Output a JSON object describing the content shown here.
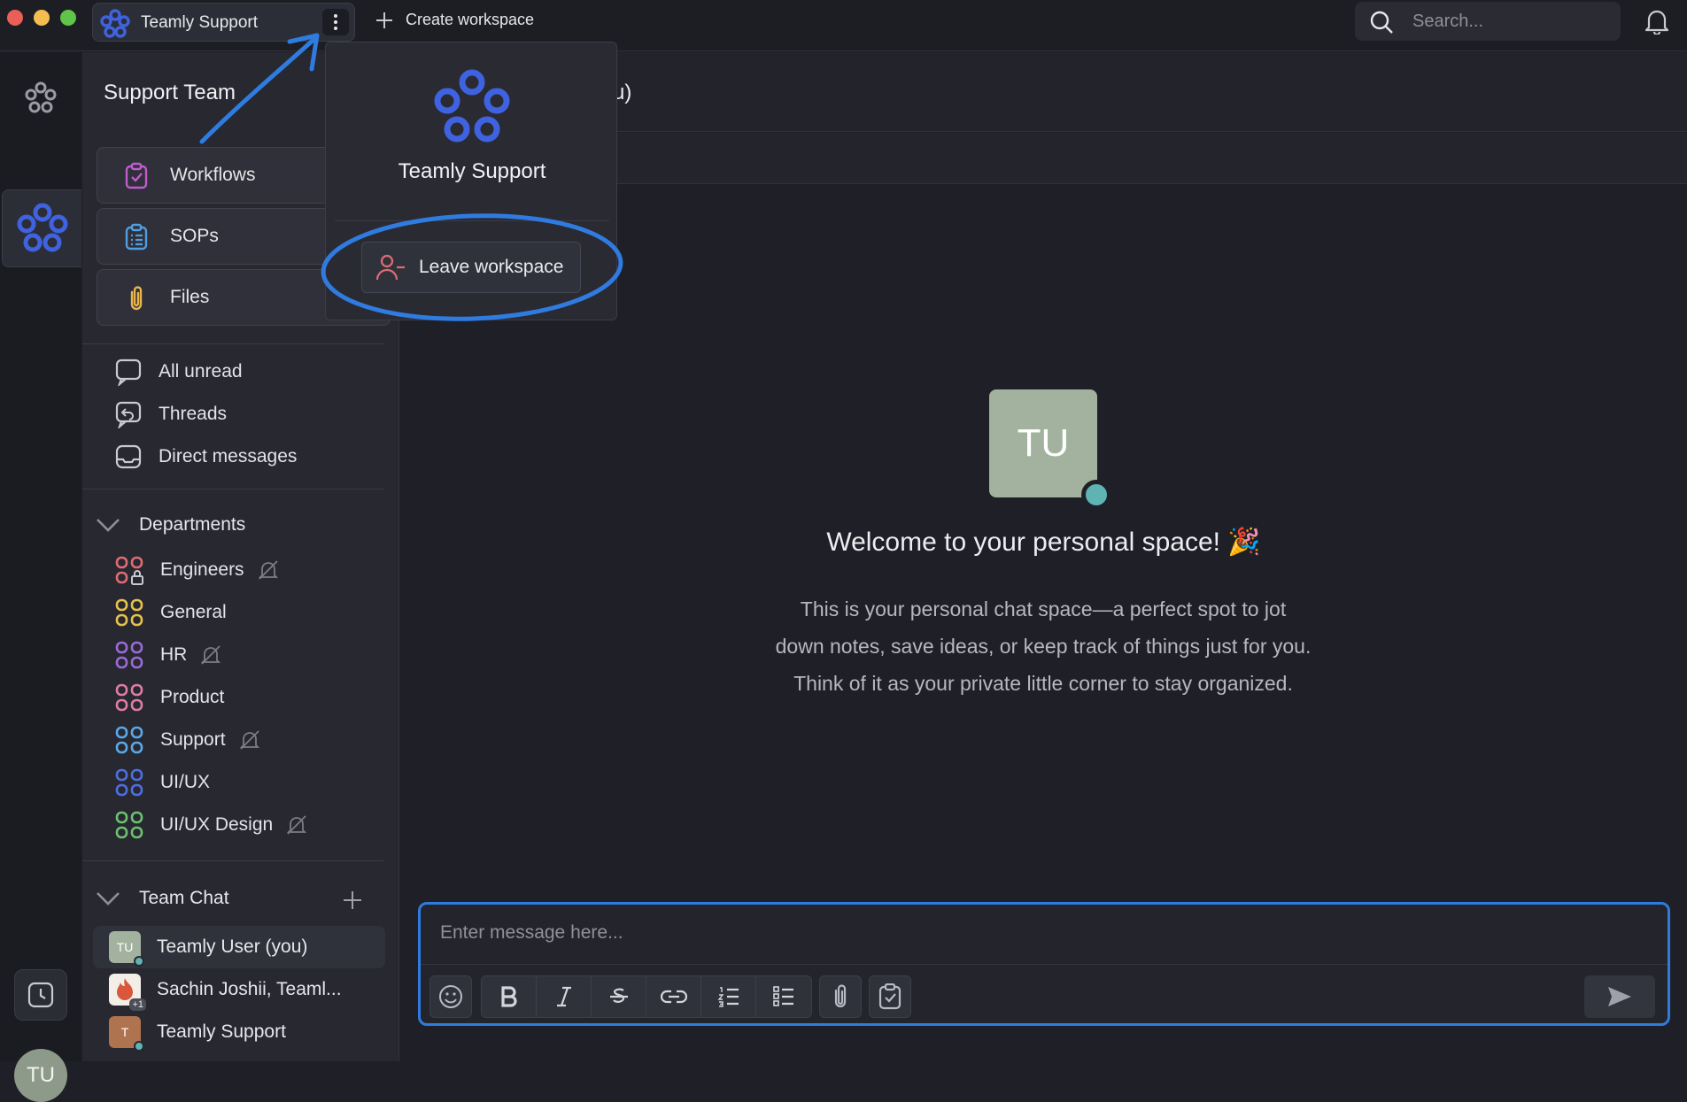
{
  "titlebar": {
    "workspace_name": "Teamly Support",
    "create_workspace_label": "Create workspace",
    "search_placeholder": "Search..."
  },
  "sidebar": {
    "title": "Support Team",
    "cards": [
      {
        "label": "Workflows",
        "icon": "clipboard-check-icon"
      },
      {
        "label": "SOPs",
        "icon": "clipboard-list-icon"
      },
      {
        "label": "Files",
        "icon": "paperclip-icon"
      }
    ],
    "nav": [
      {
        "label": "All unread",
        "icon": "chat-bubble-icon"
      },
      {
        "label": "Threads",
        "icon": "thread-reply-icon"
      },
      {
        "label": "Direct messages",
        "icon": "inbox-icon"
      }
    ],
    "departments_label": "Departments",
    "channels": [
      {
        "label": "Engineers",
        "color": "#e06b74",
        "muted": true,
        "locked": true
      },
      {
        "label": "General",
        "color": "#e7c14a",
        "muted": false
      },
      {
        "label": "HR",
        "color": "#9b6ad8",
        "muted": true
      },
      {
        "label": "Product",
        "color": "#e07aa8",
        "muted": false
      },
      {
        "label": "Support",
        "color": "#5aa8e6",
        "muted": true
      },
      {
        "label": "UI/UX",
        "color": "#4d6fe0",
        "muted": false
      },
      {
        "label": "UI/UX Design",
        "color": "#6cc070",
        "muted": true
      }
    ],
    "team_chat_label": "Team Chat",
    "dms": [
      {
        "label": "Teamly User (you)",
        "initials": "TU",
        "color": "#a2b29e",
        "online": true,
        "active": true
      },
      {
        "label": "Sachin Joshii, Teaml...",
        "initials": "+1",
        "color": "#d9583b",
        "online": false,
        "active": false
      },
      {
        "label": "Teamly Support",
        "initials": "T",
        "color": "#b0734f",
        "online": true,
        "active": false
      }
    ]
  },
  "rail": {
    "avatar_initials": "TU"
  },
  "popup": {
    "workspace_name": "Teamly Support",
    "leave_label": "Leave workspace"
  },
  "main": {
    "header_fragment": "u)",
    "avatar_initials": "TU",
    "welcome": "Welcome to your personal space! 🎉",
    "desc_lines": [
      "This is your personal chat space—a perfect spot to jot",
      "down notes, save ideas, or keep track of things just for you.",
      "Think of it as your private little corner to stay organized."
    ],
    "composer_placeholder": "Enter message here..."
  },
  "colors": {
    "accent": "#3f63e0",
    "annotation": "#2f7be0"
  }
}
